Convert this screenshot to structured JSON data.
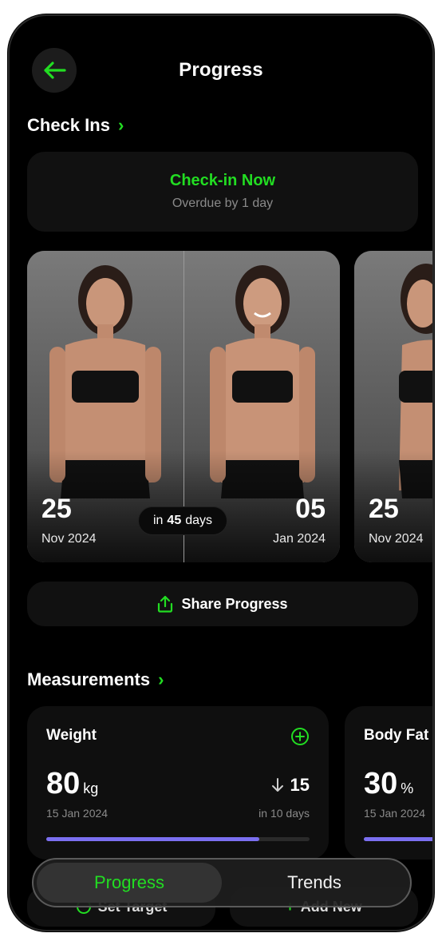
{
  "header": {
    "title": "Progress"
  },
  "checkins": {
    "section_title": "Check Ins",
    "card_title": "Check-in Now",
    "card_subtitle": "Overdue by 1 day"
  },
  "photos": {
    "before": {
      "day": "25",
      "month_year": "Nov 2024"
    },
    "after": {
      "day": "05",
      "month_year": "Jan 2024"
    },
    "gap_prefix": "in",
    "gap_days": "45",
    "gap_suffix": "days",
    "next": {
      "day": "25",
      "month_year": "Nov 2024"
    }
  },
  "share": {
    "label": "Share Progress"
  },
  "measurements": {
    "section_title": "Measurements",
    "weight": {
      "label": "Weight",
      "value": "80",
      "unit": "kg",
      "date": "15 Jan 2024",
      "delta": "15",
      "delta_sub": "in 10 days",
      "progress": 0.81
    },
    "body_fat": {
      "label": "Body Fat",
      "value": "30",
      "unit": "%",
      "date": "15 Jan 2024"
    }
  },
  "actions": {
    "set_target": "Set Target",
    "add_new": "Add New"
  },
  "tabs": {
    "progress": "Progress",
    "trends": "Trends"
  },
  "colors": {
    "accent_green": "#22dd22",
    "progress_purple": "#7b6ff0",
    "background": "#000000"
  }
}
